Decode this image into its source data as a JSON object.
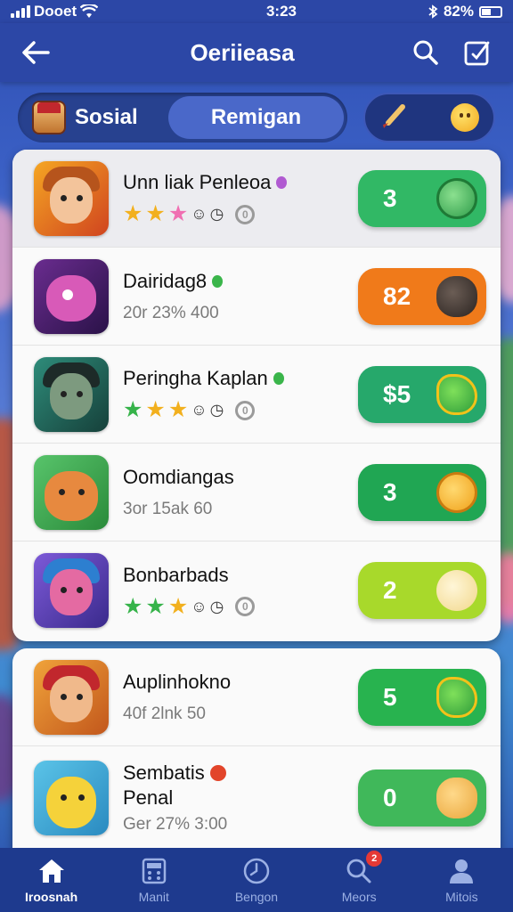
{
  "status_bar": {
    "carrier": "Dooet",
    "time": "3:23",
    "battery": "82%"
  },
  "header": {
    "title": "Oeriieasa"
  },
  "tabs": {
    "left_label": "Sosial",
    "active_label": "Remigan"
  },
  "colors": {
    "header_bg": "#2c47a6",
    "nav_bg": "#1e3a8e",
    "green": "#31b865",
    "orange": "#f07a1a",
    "lime": "#a8d92b"
  },
  "games": [
    {
      "title": "Unn liak Penleoa",
      "rating_text": "0",
      "price": "3",
      "btn_color": "#31b865",
      "coin_icon": "green-face-coin-icon"
    },
    {
      "title": "Dairidag8",
      "subtitle": "20r 23% 400",
      "price": "82",
      "btn_color": "#f07a1a",
      "coin_icon": "black-blob-icon"
    },
    {
      "title": "Peringha Kaplan",
      "rating_text": "0",
      "price": "$5",
      "btn_color": "#26a86b",
      "coin_icon": "green-shield-icon"
    },
    {
      "title": "Oomdiangas",
      "subtitle": "3or 15ak 60",
      "price": "3",
      "btn_color": "#20a653",
      "coin_icon": "clock-coin-icon"
    },
    {
      "title": "Bonbarbads",
      "rating_text": "0",
      "price": "2",
      "btn_color": "#a8d92b",
      "coin_icon": "cartoon-face-icon"
    },
    {
      "title": "Auplinhokno",
      "subtitle": "40f 2lnk 50",
      "price": "5",
      "btn_color": "#28b34f",
      "coin_icon": "green-shield-icon"
    },
    {
      "title": "Sembatis",
      "title_line2": "Penal",
      "subtitle": "Ger 27% 3:00",
      "price": "0",
      "btn_color": "#40b85a",
      "coin_icon": "cookie-face-icon"
    }
  ],
  "nav": {
    "items": [
      {
        "label": "Iroosnah",
        "icon": "home-icon"
      },
      {
        "label": "Manit",
        "icon": "calculator-icon"
      },
      {
        "label": "Bengon",
        "icon": "clock-icon"
      },
      {
        "label": "Meors",
        "icon": "search-icon",
        "badge": "2"
      },
      {
        "label": "Mitois",
        "icon": "profile-icon"
      }
    ]
  }
}
